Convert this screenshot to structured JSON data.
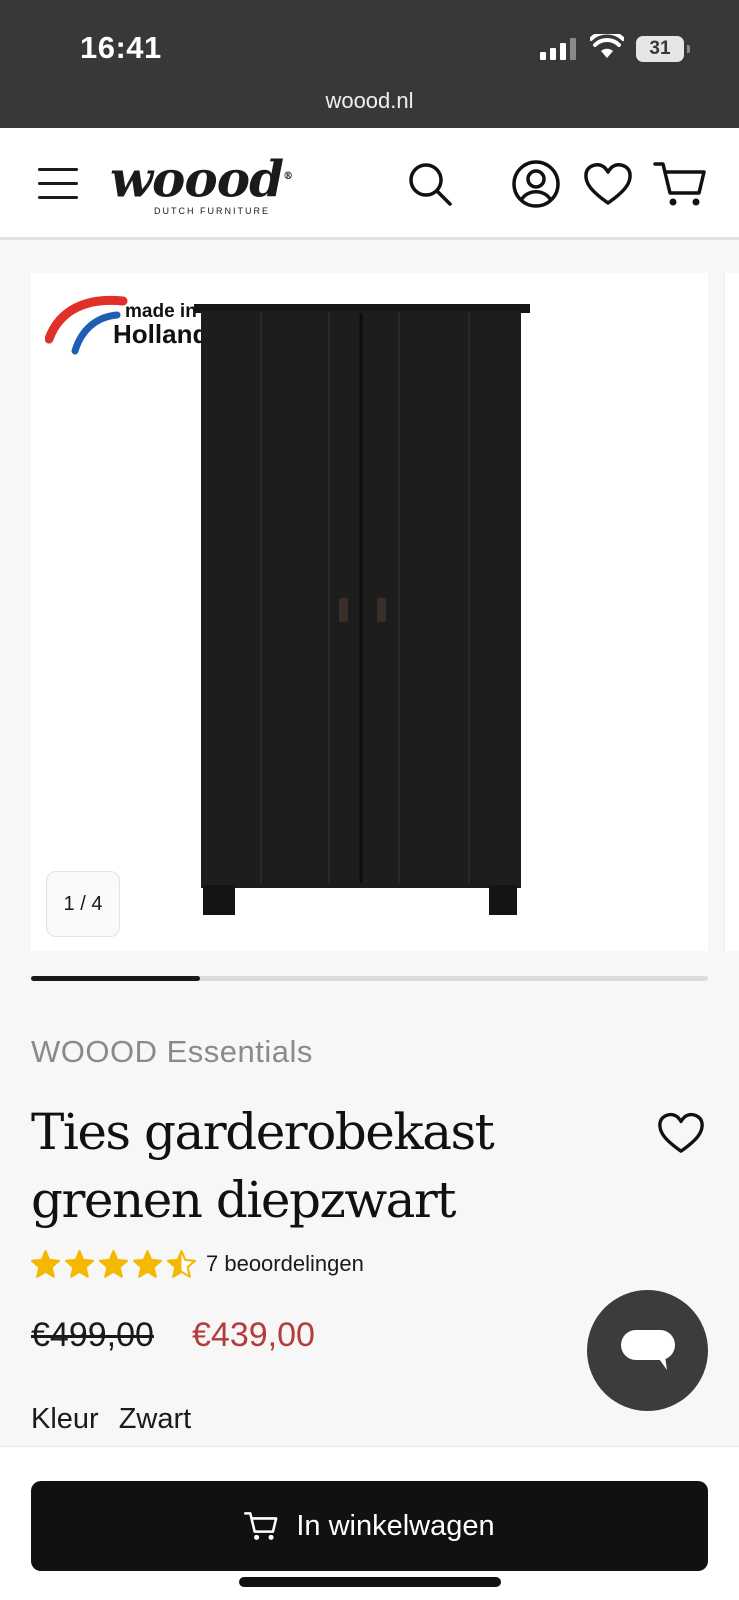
{
  "status": {
    "time": "16:41",
    "battery": "31"
  },
  "browser": {
    "url": "woood.nl"
  },
  "header": {
    "logo_word": "woood",
    "logo_reg": "®",
    "logo_sub": "DUTCH FURNITURE"
  },
  "gallery": {
    "badge_line1": "made in",
    "badge_line2": "Holland",
    "counter": "1 / 4",
    "current_slide": 1,
    "total_slides": 4
  },
  "product": {
    "brand": "WOOOD Essentials",
    "title_line1": "Ties garderobekast",
    "title_line2": "grenen diepzwart",
    "rating_value": 4.5,
    "rating_text": "7 beoordelingen",
    "price_old": "€499,00",
    "price_new": "€439,00",
    "colour_label": "Kleur",
    "colour_value": "Zwart"
  },
  "cta": {
    "label": "In winkelwagen"
  },
  "colors": {
    "status_bg": "#363839",
    "price_sale": "#b33c3c",
    "star": "#f5b800",
    "cta_bg": "#111111"
  },
  "icons": [
    "menu-icon",
    "search-icon",
    "account-icon",
    "heart-icon",
    "cart-icon",
    "star-icon",
    "chat-icon"
  ]
}
